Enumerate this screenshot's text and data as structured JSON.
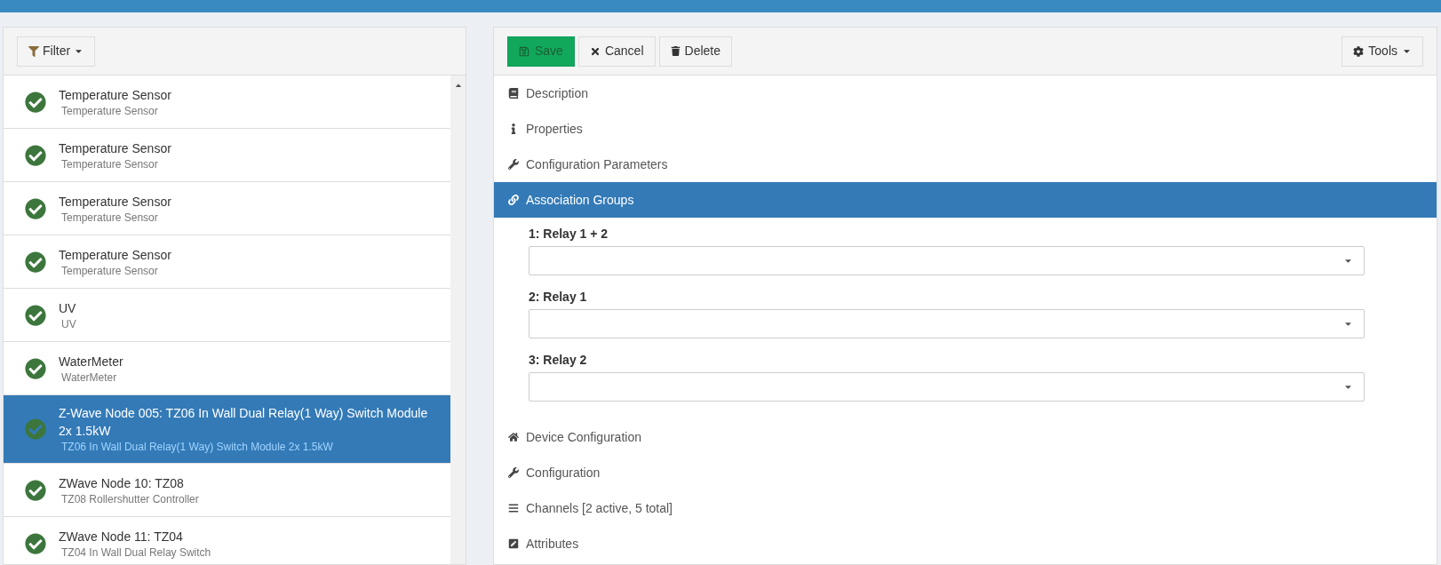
{
  "toolbar_left": {
    "filter_button": "Filter"
  },
  "devices": [
    {
      "title": "Temperature Sensor",
      "subtitle": "Temperature Sensor",
      "online": true,
      "selected": false
    },
    {
      "title": "Temperature Sensor",
      "subtitle": "Temperature Sensor",
      "online": true,
      "selected": false
    },
    {
      "title": "Temperature Sensor",
      "subtitle": "Temperature Sensor",
      "online": true,
      "selected": false
    },
    {
      "title": "Temperature Sensor",
      "subtitle": "Temperature Sensor",
      "online": true,
      "selected": false
    },
    {
      "title": "UV",
      "subtitle": "UV",
      "online": true,
      "selected": false
    },
    {
      "title": "WaterMeter",
      "subtitle": "WaterMeter",
      "online": true,
      "selected": false
    },
    {
      "title": "Z-Wave Node 005: TZ06 In Wall Dual Relay(1 Way) Switch Module 2x 1.5kW",
      "subtitle": "TZ06 In Wall Dual Relay(1 Way) Switch Module 2x 1.5kW",
      "online": true,
      "selected": true
    },
    {
      "title": "ZWave Node 10: TZ08",
      "subtitle": "TZ08 Rollershutter Controller",
      "online": true,
      "selected": false
    },
    {
      "title": "ZWave Node 11: TZ04",
      "subtitle": "TZ04 In Wall Dual Relay Switch",
      "online": true,
      "selected": false
    }
  ],
  "toolbar_right": {
    "save": "Save",
    "cancel": "Cancel",
    "delete": "Delete",
    "tools": "Tools"
  },
  "sections": [
    {
      "kind": "book",
      "label": "Description",
      "selected": false
    },
    {
      "kind": "info",
      "label": "Properties",
      "selected": false
    },
    {
      "kind": "wrench",
      "label": "Configuration Parameters",
      "selected": false
    },
    {
      "kind": "link",
      "label": "Association Groups",
      "selected": true,
      "groups": [
        {
          "label": "1: Relay 1 + 2"
        },
        {
          "label": "2: Relay 1"
        },
        {
          "label": "3: Relay 2"
        }
      ]
    },
    {
      "kind": "home",
      "label": "Device Configuration",
      "selected": false
    },
    {
      "kind": "wrench",
      "label": "Configuration",
      "selected": false
    },
    {
      "kind": "bars",
      "label": "Channels [2 active, 5 total]",
      "selected": false
    },
    {
      "kind": "edit",
      "label": "Attributes",
      "selected": false
    }
  ]
}
